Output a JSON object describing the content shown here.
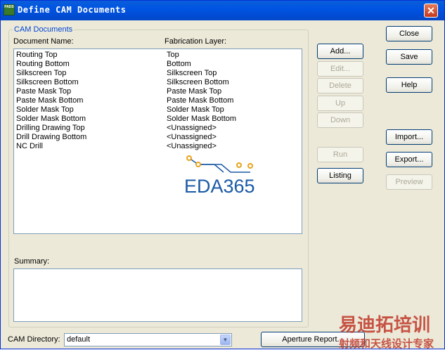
{
  "window": {
    "title": "Define CAM Documents",
    "icon_text": "PADS",
    "close_glyph": "✕"
  },
  "group": {
    "label": "CAM Documents"
  },
  "columns": {
    "doc_name": "Document Name:",
    "fab_layer": "Fabrication Layer:"
  },
  "documents": [
    {
      "name": "Routing Top",
      "layer": "Top"
    },
    {
      "name": "Routing Bottom",
      "layer": "Bottom"
    },
    {
      "name": "Silkscreen Top",
      "layer": "Silkscreen Top"
    },
    {
      "name": "Silkscreen Bottom",
      "layer": "Silkscreen Bottom"
    },
    {
      "name": "Paste Mask Top",
      "layer": "Paste Mask Top"
    },
    {
      "name": "Paste Mask Bottom",
      "layer": "Paste Mask Bottom"
    },
    {
      "name": "Solder Mask Top",
      "layer": "Solder Mask Top"
    },
    {
      "name": "Solder Mask Bottom",
      "layer": "Solder Mask Bottom"
    },
    {
      "name": "Drilling Drawing Top",
      "layer": "<Unassigned>"
    },
    {
      "name": "Drill Drawing Bottom",
      "layer": "<Unassigned>"
    },
    {
      "name": "NC Drill",
      "layer": "<Unassigned>"
    }
  ],
  "logo": {
    "text": "EDA365",
    "color": "#1a5aa6",
    "dot_color": "#e8a31b"
  },
  "summary": {
    "label": "Summary:"
  },
  "buttons": {
    "add": "Add...",
    "edit": "Edit...",
    "delete": "Delete",
    "up": "Up",
    "down": "Down",
    "run": "Run",
    "listing": "Listing",
    "close": "Close",
    "save": "Save",
    "help": "Help",
    "import": "Import...",
    "export": "Export...",
    "preview": "Preview",
    "aperture": "Aperture Report..."
  },
  "cam_directory": {
    "label": "CAM Directory:",
    "value": "default"
  },
  "watermark": {
    "line1": "易迪拓培训",
    "line2": "射频和天线设计专家",
    "color": "#c0392b"
  }
}
